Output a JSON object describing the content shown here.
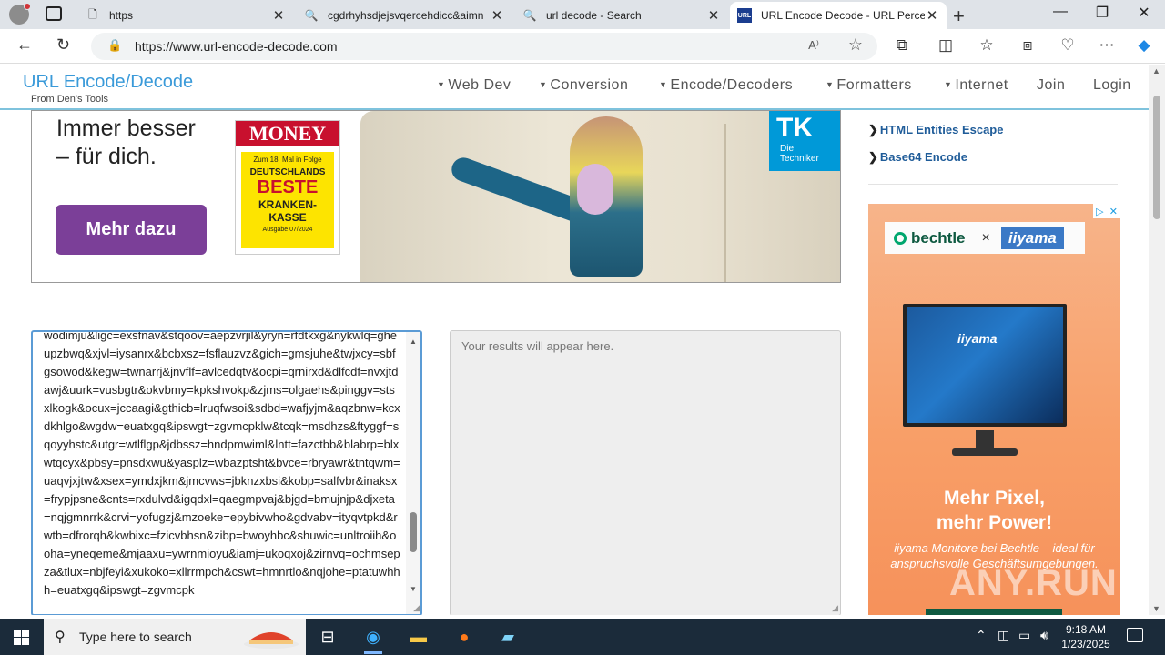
{
  "browser": {
    "tabs": [
      {
        "title": "https",
        "icon": "page-icon"
      },
      {
        "title": "cgdrhyhsdjejsvqercehdicc&aimn",
        "icon": "search-icon"
      },
      {
        "title": "url decode - Search",
        "icon": "search-icon"
      },
      {
        "title": "URL Encode Decode - URL Percer",
        "icon": "site-icon",
        "active": true
      }
    ],
    "address": "https://www.url-encode-decode.com"
  },
  "site": {
    "title": "URL Encode/Decode",
    "subtitle": "From Den's Tools",
    "menu": [
      {
        "label": "Web Dev",
        "caret": true
      },
      {
        "label": "Conversion",
        "caret": true
      },
      {
        "label": "Encode/Decoders",
        "caret": true
      },
      {
        "label": "Formatters",
        "caret": true
      },
      {
        "label": "Internet",
        "caret": true
      },
      {
        "label": "Join",
        "caret": false
      },
      {
        "label": "Login",
        "caret": false
      }
    ]
  },
  "ad_main": {
    "headline_1": "Immer besser",
    "headline_2": "– für dich.",
    "cta": "Mehr dazu",
    "money_title": "MONEY",
    "money_line1": "Zum 18. Mal in Folge",
    "money_line2": "DEUTSCHLANDS",
    "money_line3": "BESTE",
    "money_line4": "KRANKEN-",
    "money_line5": "KASSE",
    "money_line6": "Ausgabe 07/2024",
    "tk_line1": "Die",
    "tk_line2": "Techniker"
  },
  "sidebar": {
    "links": [
      "HTML Entities Escape",
      "Base64 Encode"
    ]
  },
  "ad_side": {
    "brand1": "bechtle",
    "brand2": "iiyama",
    "monitor_label": "iiyama",
    "headline_1": "Mehr Pixel,",
    "headline_2": "mehr Power!",
    "body": "iiyama Monitore bei Bechtle – ideal für anspruchsvolle Geschäftsumgebungen.",
    "watermark": "ANY.RUN"
  },
  "input": {
    "value": "wodimju&ligc=exsfnav&stqoov=aepzvrjil&yryn=rfdtkxg&nykwlq=gheupzbwq&xjvl=iysanrx&bcbxsz=fsflauzvz&gich=gmsjuhe&twjxcy=sbfgsowod&kegw=twnarrj&jnvflf=avlcedqtv&ocpi=qrnirxd&dlfcdf=nvxjtdawj&uurk=vusbgtr&okvbmy=kpkshvokp&zjms=olgaehs&pinggv=stsxlkogk&ocux=jccaagi&gthicb=lruqfwsoi&sdbd=wafjyjm&aqzbnw=kcxdkhlgo&wgdw=euatxgq&ipswgt=zgvmcpklw&tcqk=msdhzs&ftyggf=sqoyyhstc&utgr=wtlflgp&jdbssz=hndpmwiml&lntt=fazctbb&blabrp=blxwtqcyx&pbsy=pnsdxwu&yasplz=wbazptsht&bvce=rbryawr&tntqwm=uaqvjxjtw&xsex=ymdxjkm&jmcvws=jbknzxbsi&kobp=salfvbr&inaksx=frypjpsne&cnts=rxdulvd&igqdxl=qaegmpvaj&bjgd=bmujnjp&djxeta=nqjgmnrrk&crvi=yofugzj&mzoeke=epybivwho&gdvabv=ityqvtpkd&rwtb=dfrorqh&kwbixc=fzicvbhsn&zibp=bwoyhbc&shuwic=unltroiih&ooha=yneqeme&mjaaxu=ywrnmioyu&iamj=ukoqxoj&zirnvq=ochmsepza&tlux=nbjfeyi&xukoko=xllrrmpch&cswt=hmnrtlo&nqjohe=ptatuwhhh=euatxgq&ipswgt=zgvmcpk"
  },
  "output": {
    "placeholder": "Your results will appear here."
  },
  "taskbar": {
    "search_placeholder": "Type here to search",
    "time": "9:18 AM",
    "date": "1/23/2025"
  }
}
